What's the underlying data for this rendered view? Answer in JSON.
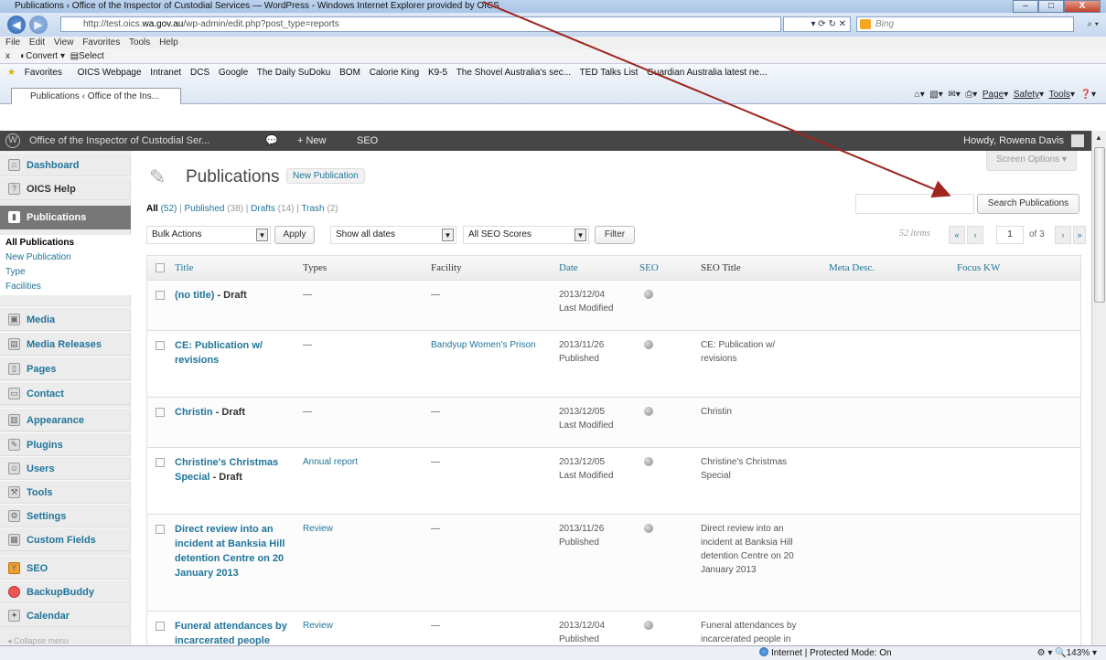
{
  "browser": {
    "title": "Publications ‹ Office of the Inspector of Custodial Services — WordPress - Windows Internet Explorer provided by OICS",
    "url_prefix": "http://test.oics.",
    "url_domain": "wa.gov.au",
    "url_suffix": "/wp-admin/edit.php?post_type=reports",
    "search_engine": "Bing",
    "menu": [
      "File",
      "Edit",
      "View",
      "Favorites",
      "Tools",
      "Help"
    ],
    "convert": "Convert",
    "select": "Select",
    "favorites_label": "Favorites",
    "favorites": [
      "OICS Webpage",
      "Intranet",
      "DCS",
      "Google",
      "The Daily SuDoku",
      "BOM",
      "Calorie King",
      "K9-5",
      "The Shovel Australia's sec...",
      "TED Talks List",
      "Guardian Australia latest ne..."
    ],
    "tab_title": "Publications ‹ Office of the Ins...",
    "cmd": {
      "page": "Page",
      "safety": "Safety",
      "tools": "Tools"
    },
    "status_zone": "Internet | Protected Mode: On",
    "zoom": "143%"
  },
  "adminbar": {
    "site": "Office of the Inspector of Custodial Ser...",
    "new": "+ New",
    "seo": "SEO",
    "howdy": "Howdy, Rowena Davis"
  },
  "sidebar": {
    "items": [
      {
        "label": "Dashboard",
        "icon": "home-icon"
      },
      {
        "label": "OICS Help",
        "icon": "help-icon"
      },
      {
        "label": "Publications",
        "icon": "publications-icon"
      },
      {
        "label": "Media",
        "icon": "media-icon"
      },
      {
        "label": "Media Releases",
        "icon": "media-releases-icon"
      },
      {
        "label": "Pages",
        "icon": "pages-icon"
      },
      {
        "label": "Contact",
        "icon": "contact-icon"
      },
      {
        "label": "Appearance",
        "icon": "appearance-icon"
      },
      {
        "label": "Plugins",
        "icon": "plugins-icon"
      },
      {
        "label": "Users",
        "icon": "users-icon"
      },
      {
        "label": "Tools",
        "icon": "tools-icon"
      },
      {
        "label": "Settings",
        "icon": "settings-icon"
      },
      {
        "label": "Custom Fields",
        "icon": "custom-fields-icon"
      },
      {
        "label": "SEO",
        "icon": "seo-icon"
      },
      {
        "label": "BackupBuddy",
        "icon": "backupbuddy-icon"
      },
      {
        "label": "Calendar",
        "icon": "calendar-icon"
      }
    ],
    "submenu": [
      "All Publications",
      "New Publication",
      "Type",
      "Facilities"
    ],
    "collapse": "Collapse menu"
  },
  "main": {
    "title": "Publications",
    "add_new": "New Publication",
    "screen_options": "Screen Options",
    "filters": {
      "all": "All",
      "all_count": "(52)",
      "published": "Published",
      "published_count": "(38)",
      "drafts": "Drafts",
      "drafts_count": "(14)",
      "trash": "Trash",
      "trash_count": "(2)"
    },
    "search_button": "Search Publications",
    "bulk_actions": "Bulk Actions",
    "apply": "Apply",
    "dates": "Show all dates",
    "seo_scores": "All SEO Scores",
    "filter": "Filter",
    "items_count": "52 items",
    "page_current": "1",
    "page_total": "of 3",
    "columns": [
      "Title",
      "Types",
      "Facility",
      "Date",
      "SEO",
      "SEO Title",
      "Meta Desc.",
      "Focus KW"
    ],
    "rows": [
      {
        "title": "(no title)",
        "state": " - Draft",
        "type": "—",
        "facility": "—",
        "date": "2013/12/04",
        "status": "Last Modified",
        "seo_title": ""
      },
      {
        "title": "CE: Publication w/ revisions",
        "state": "",
        "type": "—",
        "facility": "Bandyup Women's Prison",
        "date": "2013/11/26",
        "status": "Published",
        "seo_title": "CE: Publication w/ revisions"
      },
      {
        "title": "Christin",
        "state": " - Draft",
        "type": "—",
        "facility": "—",
        "date": "2013/12/05",
        "status": "Last Modified",
        "seo_title": "Christin"
      },
      {
        "title": "Christine's Christmas Special",
        "state": " - Draft",
        "type": "Annual report",
        "facility": "—",
        "date": "2013/12/05",
        "status": "Last Modified",
        "seo_title": "Christine's Christmas Special"
      },
      {
        "title": "Direct review into an incident at Banksia Hill detention Centre on 20 January 2013",
        "state": "",
        "type": "Review",
        "facility": "—",
        "date": "2013/11/26",
        "status": "Published",
        "seo_title": "Direct review into an incident at Banksia Hill detention Centre on 20 January 2013"
      },
      {
        "title": "Funeral attendances by incarcerated people",
        "state": "",
        "type": "Review",
        "facility": "—",
        "date": "2013/12/04",
        "status": "Published",
        "seo_title": "Funeral attendances by incarcerated people in"
      }
    ]
  },
  "colors": {
    "link": "#21759b",
    "adminbar": "#464646",
    "annotation_arrow": "#a0261f"
  }
}
